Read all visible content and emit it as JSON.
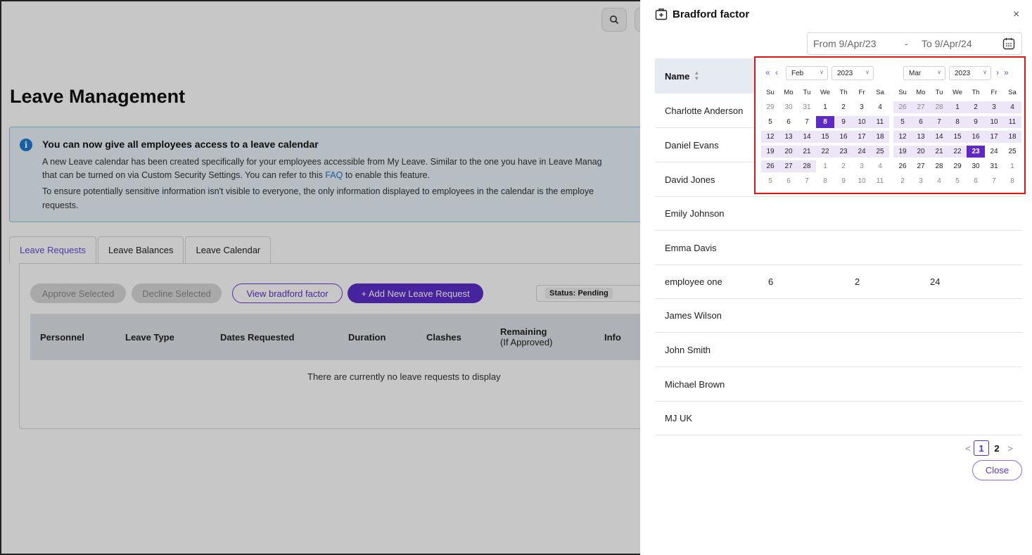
{
  "background": {
    "page_title": "Leave Management",
    "banner": {
      "heading": "You can now give all employees access to a leave calendar",
      "line1": "A new Leave calendar has been created specifically for your employees accessible from My Leave. Similar to the one you have in Leave Manag",
      "line2_pre": "that can be turned on via Custom Security Settings. You can refer to this ",
      "line2_link": "FAQ",
      "line2_post": " to enable this feature.",
      "line3": "To ensure potentially sensitive information isn't visible to everyone, the only information displayed to employees in the calendar is the employe",
      "line4": "requests."
    },
    "tabs": [
      "Leave Requests",
      "Leave Balances",
      "Leave Calendar"
    ],
    "buttons": {
      "approve": "Approve Selected",
      "decline": "Decline Selected",
      "view_bradford": "View bradford factor",
      "add_leave": "+ Add New Leave Request"
    },
    "status_filter": "Status: Pending",
    "columns": {
      "personnel": "Personnel",
      "leave_type": "Leave Type",
      "dates": "Dates Requested",
      "duration": "Duration",
      "clashes": "Clashes",
      "remaining": "Remaining",
      "remaining_sub": "(If Approved)",
      "info": "Info"
    },
    "empty_message": "There are currently no leave requests to display"
  },
  "drawer": {
    "title": "Bradford factor",
    "close_x": "×",
    "date_from": "From 9/Apr/23",
    "date_sep": "-",
    "date_to": "To 9/Apr/24",
    "name_header": "Name",
    "rows": [
      {
        "name": "Charlotte Anderson"
      },
      {
        "name": "Daniel Evans"
      },
      {
        "name": "David Jones"
      },
      {
        "name": "Emily Johnson"
      },
      {
        "name": "Emma Davis"
      },
      {
        "name": "employee one",
        "v1": "6",
        "v2": "2",
        "v3": "24"
      },
      {
        "name": "James Wilson"
      },
      {
        "name": "John Smith"
      },
      {
        "name": "Michael Brown"
      },
      {
        "name": "MJ UK"
      }
    ],
    "pagination": {
      "prev": "<",
      "pages": [
        "1",
        "2"
      ],
      "current": "1",
      "next": ">"
    },
    "close_button": "Close"
  },
  "datepicker": {
    "nav": {
      "prev_year": "«",
      "prev_month": "‹",
      "next_month": "›",
      "next_year": "»"
    },
    "weekdays": [
      "Su",
      "Mo",
      "Tu",
      "We",
      "Th",
      "Fr",
      "Sa"
    ],
    "left": {
      "month": "Feb",
      "year": "2023",
      "weeks": [
        [
          "29",
          "30",
          "31",
          "1",
          "2",
          "3",
          "4"
        ],
        [
          "5",
          "6",
          "7",
          "8",
          "9",
          "10",
          "11"
        ],
        [
          "12",
          "13",
          "14",
          "15",
          "16",
          "17",
          "18"
        ],
        [
          "19",
          "20",
          "21",
          "22",
          "23",
          "24",
          "25"
        ],
        [
          "26",
          "27",
          "28",
          "1",
          "2",
          "3",
          "4"
        ],
        [
          "5",
          "6",
          "7",
          "8",
          "9",
          "10",
          "11"
        ]
      ]
    },
    "right": {
      "month": "Mar",
      "year": "2023",
      "weeks": [
        [
          "26",
          "27",
          "28",
          "1",
          "2",
          "3",
          "4"
        ],
        [
          "5",
          "6",
          "7",
          "8",
          "9",
          "10",
          "11"
        ],
        [
          "12",
          "13",
          "14",
          "15",
          "16",
          "17",
          "18"
        ],
        [
          "19",
          "20",
          "21",
          "22",
          "23",
          "24",
          "25"
        ],
        [
          "26",
          "27",
          "28",
          "29",
          "30",
          "31",
          "1"
        ],
        [
          "2",
          "3",
          "4",
          "5",
          "6",
          "7",
          "8"
        ]
      ]
    },
    "range_start": "8 Feb 2023",
    "range_end": "23 Mar 2023",
    "colors": {
      "accent": "#6029c7",
      "range": "#ece6f8",
      "highlight_border": "#e01414"
    }
  }
}
